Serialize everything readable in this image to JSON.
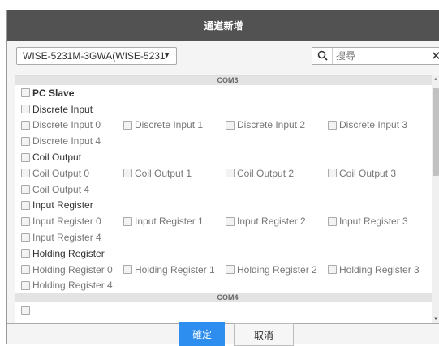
{
  "dialog": {
    "title": "通道新增"
  },
  "toolbar": {
    "device_select_value": "WISE-5231M-3GWA(WISE-5231",
    "search_placeholder": "搜尋",
    "clear_label": "✕"
  },
  "groups": [
    {
      "header": "COM3",
      "root_label": "PC Slave",
      "sections": [
        {
          "label": "Discrete Input",
          "items": [
            "Discrete Input 0",
            "Discrete Input 1",
            "Discrete Input 2",
            "Discrete Input 3",
            "Discrete Input 4"
          ]
        },
        {
          "label": "Coil Output",
          "items": [
            "Coil Output 0",
            "Coil Output 1",
            "Coil Output 2",
            "Coil Output 3",
            "Coil Output 4"
          ]
        },
        {
          "label": "Input Register",
          "items": [
            "Input Register 0",
            "Input Register 1",
            "Input Register 2",
            "Input Register 3",
            "Input Register 4"
          ]
        },
        {
          "label": "Holding Register",
          "items": [
            "Holding Register 0",
            "Holding Register 1",
            "Holding Register 2",
            "Holding Register 3",
            "Holding Register 4"
          ]
        }
      ]
    },
    {
      "header": "COM4"
    }
  ],
  "footer": {
    "ok_label": "確定",
    "cancel_label": "取消"
  }
}
